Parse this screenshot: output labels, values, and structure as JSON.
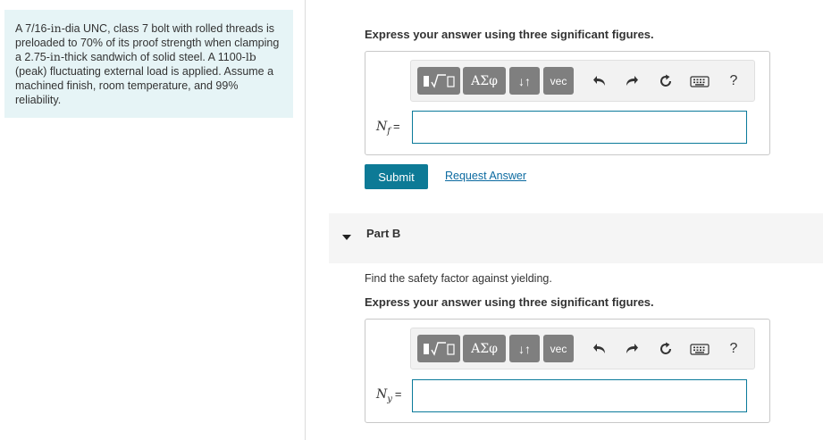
{
  "problem": {
    "segments": [
      {
        "t": "A 7/16-",
        "mono": false
      },
      {
        "t": "in",
        "mono": true
      },
      {
        "t": "-dia UNC, class 7 bolt with rolled threads is preloaded to 70% of its proof strength when clamping a 2.75-",
        "mono": false
      },
      {
        "t": "in",
        "mono": true
      },
      {
        "t": "-thick sandwich of solid steel. A 1100-",
        "mono": false
      },
      {
        "t": "lb",
        "mono": true
      },
      {
        "t": " (peak) fluctuating external load is applied. Assume a machined finish, room temperature, and 99% reliability.",
        "mono": false
      }
    ]
  },
  "part_a": {
    "instruction": "Express your answer using three significant figures.",
    "variable_main": "N",
    "variable_sub": "f",
    "equals": "=",
    "answer_value": ""
  },
  "toolbar": {
    "templates_icon": "templates-sqrt-icon",
    "greek_label": "ΑΣφ",
    "arrows_label": "↓↑",
    "vec_label": "vec",
    "help_label": "?"
  },
  "actions": {
    "submit_label": "Submit",
    "request_answer_label": "Request Answer"
  },
  "part_b": {
    "title": "Part B",
    "prompt": "Find the safety factor against yielding.",
    "instruction": "Express your answer using three significant figures.",
    "variable_main": "N",
    "variable_sub": "y",
    "equals": "=",
    "answer_value": ""
  },
  "colors": {
    "problem_bg": "#e6f4f6",
    "submit_bg": "#0d7a96",
    "link": "#0b6aa0",
    "input_border": "#0a7a9a",
    "toolbar_button": "#7f7f7f"
  }
}
